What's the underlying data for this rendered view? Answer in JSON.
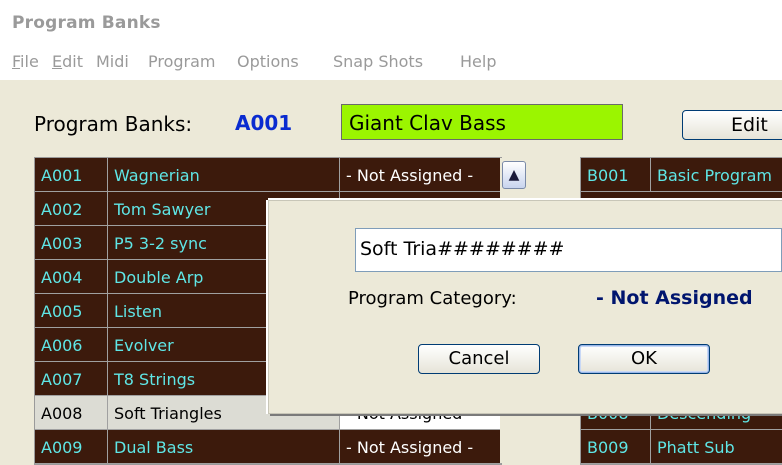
{
  "window": {
    "title": "Program Banks"
  },
  "menu": [
    {
      "label": "File",
      "u": "F",
      "rest": "ile"
    },
    {
      "label": "Edit",
      "u": "E",
      "rest": "dit"
    },
    {
      "label": "Midi",
      "u": "",
      "rest": "Midi"
    },
    {
      "label": "Program",
      "u": "",
      "rest": "Program"
    },
    {
      "label": "Options",
      "u": "",
      "rest": "Options"
    },
    {
      "label": "Snap Shots",
      "u": "",
      "rest": "Snap Shots"
    },
    {
      "label": "Help",
      "u": "",
      "rest": "Help"
    }
  ],
  "header": {
    "label": "Program Banks:",
    "current_code": "A001",
    "current_name": "Giant Clav Bass",
    "edit_label": "Edit"
  },
  "bank_a": [
    {
      "code": "A001",
      "name": "Wagnerian",
      "category": "- Not Assigned -"
    },
    {
      "code": "A002",
      "name": "Tom Sawyer",
      "category": ""
    },
    {
      "code": "A003",
      "name": "P5 3-2 sync",
      "category": ""
    },
    {
      "code": "A004",
      "name": "Double Arp",
      "category": ""
    },
    {
      "code": "A005",
      "name": "Listen",
      "category": ""
    },
    {
      "code": "A006",
      "name": "Evolver",
      "category": ""
    },
    {
      "code": "A007",
      "name": "T8 Strings",
      "category": ""
    },
    {
      "code": "A008",
      "name": "Soft Triangles",
      "category": "- Not Assigned -"
    },
    {
      "code": "A009",
      "name": "Dual Bass",
      "category": "- Not Assigned -"
    }
  ],
  "bank_b": [
    {
      "code": "B001",
      "name": "Basic Program"
    },
    {
      "code": "B008",
      "name": "Descending"
    },
    {
      "code": "B009",
      "name": "Phatt Sub"
    }
  ],
  "dialog": {
    "name_value": "Soft Tria########",
    "category_label": "Program Category:",
    "category_value": "- Not Assigned",
    "cancel_label": "Cancel",
    "ok_label": "OK"
  },
  "colors": {
    "dark_row": "#3c1a0c",
    "dark_row_text": "#5fe6e6",
    "selected_row": "#dcdcd4",
    "name_field": "#9bf500",
    "code_accent": "#0a2bd0"
  }
}
